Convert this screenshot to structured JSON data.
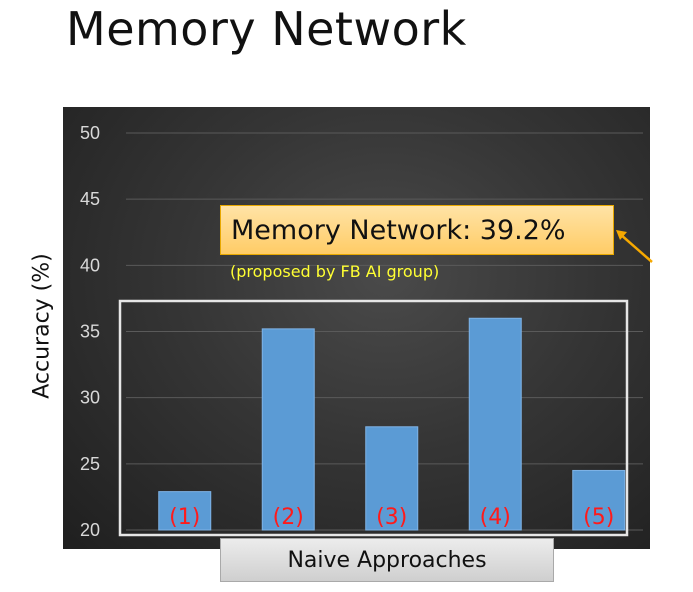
{
  "slide": {
    "title": "Memory Network",
    "callout_label": "Memory Network: 39.2%",
    "callout_note": "(proposed by FB AI group)",
    "group_label": "Naive Approaches"
  },
  "colors": {
    "bar": "#5b9bd5",
    "bar_label": "#ff1a1a",
    "callout_fill": "#ffcc66",
    "callout_note": "#ffff33",
    "arrow": "#f5a800",
    "tick_label": "#d9d9d9"
  },
  "chart_data": {
    "type": "bar",
    "categories": [
      "(1)",
      "(2)",
      "(3)",
      "(4)",
      "(5)"
    ],
    "values": [
      22.9,
      35.2,
      27.8,
      36.0,
      24.5
    ],
    "title": "",
    "xlabel": "Naive Approaches",
    "ylabel": "Accuracy (%)",
    "ylim": [
      20,
      50
    ],
    "yticks": [
      20,
      25,
      30,
      35,
      40,
      45,
      50
    ],
    "grid": true,
    "annotation": "Memory Network: 39.2%"
  }
}
